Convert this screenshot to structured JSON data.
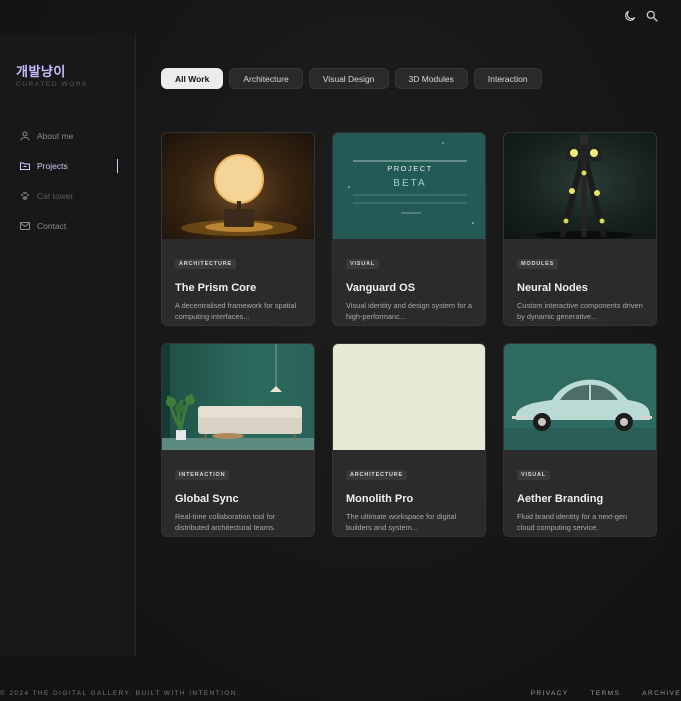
{
  "top_icons": [
    "moon-icon",
    "search-icon"
  ],
  "sidebar": {
    "brand": "개발냥이",
    "brand_sub": "CURATED WORK",
    "items": [
      {
        "label": "About me",
        "icon": "user-icon"
      },
      {
        "label": "Projects",
        "icon": "folder-icon"
      },
      {
        "label": "Cat tower",
        "icon": "paw-icon"
      },
      {
        "label": "Contact",
        "icon": "mail-icon"
      }
    ]
  },
  "filters": [
    "All Work",
    "Architecture",
    "Visual Design",
    "3D Modules",
    "Interaction"
  ],
  "cards": [
    {
      "tag": "ARCHITECTURE",
      "title": "The Prism Core",
      "desc": "A decentralised framework for spatial computing interfaces..."
    },
    {
      "tag": "VISUAL",
      "title": "Vanguard OS",
      "desc": "Visual identity and design system for a high-performanc...",
      "thumb_text": {
        "l1": "PROJECT",
        "l2": "BETA"
      }
    },
    {
      "tag": "MODULES",
      "title": "Neural Nodes",
      "desc": "Custom interactive components driven by dynamic generative..."
    },
    {
      "tag": "INTERACTION",
      "title": "Global Sync",
      "desc": "Real-time collaboration tool for distributed architectural teams."
    },
    {
      "tag": "ARCHITECTURE",
      "title": "Monolith Pro",
      "desc": "The ultimate workspace for digital builders and system..."
    },
    {
      "tag": "VISUAL",
      "title": "Aether Branding",
      "desc": "Fluid brand identity for a next-gen cloud computing service."
    }
  ],
  "footer": {
    "copyright": "© 2024 THE DIGITAL GALLERY. BUILT WITH INTENTION.",
    "links": [
      "PRIVACY",
      "TERMS",
      "ARCHIVE"
    ]
  },
  "colors": {
    "accent": "#c9b8ff",
    "chip_active_bg": "#ececec",
    "card_bg": "#2b2b2b"
  }
}
